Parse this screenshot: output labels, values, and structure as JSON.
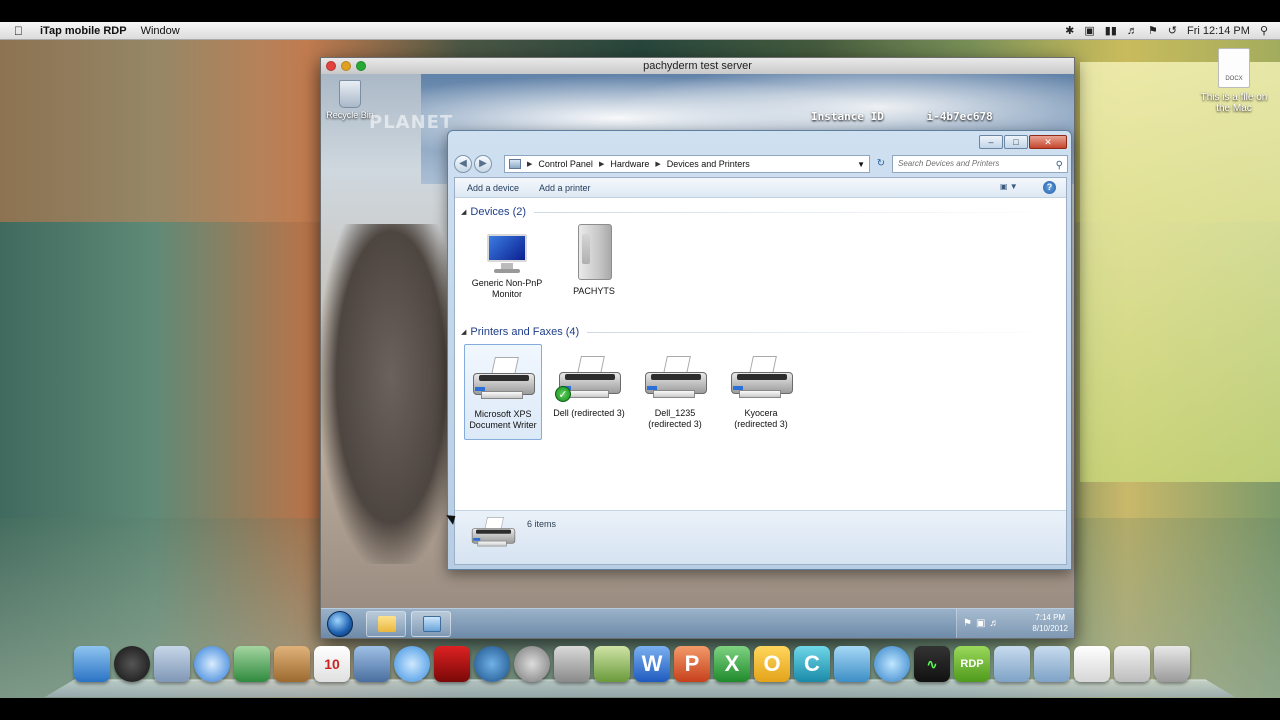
{
  "mac": {
    "menubar": {
      "apple": "",
      "app_name": "iTap mobile RDP",
      "menu_window": "Window",
      "clock": "Fri 12:14 PM",
      "status_icons": [
        "bluetooth-icon",
        "display-icon",
        "battery-icon",
        "volume-icon",
        "flag-icon",
        "timemachine-icon",
        "spotlight-icon"
      ]
    },
    "desktop_file": {
      "badge": "DOCX",
      "label": "This is a file on the Mac"
    },
    "dock_icons": [
      "finder",
      "dashboard",
      "preview",
      "safari",
      "facetime",
      "address-book",
      "ical",
      "iphoto",
      "itunes",
      "photobooth",
      "time-machine",
      "system-preferences",
      "installer",
      "stickies",
      "word",
      "powerpoint",
      "excel",
      "outlook",
      "messenger",
      "lync",
      "network",
      "activity-monitor",
      "rdp",
      "folder",
      "documents",
      "file",
      "keyboard",
      "trash"
    ]
  },
  "rdp": {
    "window_title": "pachyderm test server",
    "win_desktop": {
      "recycle_bin": "Recycle Bin",
      "logo_text": "PLANET",
      "instance_label": "Instance ID",
      "instance_value": "i-4b7ec678"
    },
    "taskbar": {
      "time": "7:14 PM",
      "date": "8/10/2012"
    }
  },
  "devices_printers": {
    "breadcrumb": [
      "Control Panel",
      "Hardware",
      "Devices and Printers"
    ],
    "search_placeholder": "Search Devices and Printers",
    "commands": {
      "add_device": "Add a device",
      "add_printer": "Add a printer"
    },
    "groups": {
      "devices": {
        "title": "Devices (2)",
        "items": [
          {
            "label": "Generic Non-PnP Monitor",
            "icon": "monitor-icon"
          },
          {
            "label": "PACHYTS",
            "icon": "computer-icon"
          }
        ]
      },
      "printers": {
        "title": "Printers and Faxes (4)",
        "items": [
          {
            "label": "Microsoft XPS Document Writer",
            "icon": "printer-icon",
            "selected": true
          },
          {
            "label": "Dell (redirected 3)",
            "icon": "printer-icon",
            "default": true
          },
          {
            "label": "Dell_1235 (redirected 3)",
            "icon": "printer-icon"
          },
          {
            "label": "Kyocera (redirected 3)",
            "icon": "printer-icon"
          }
        ]
      }
    },
    "status": {
      "count": "6 items"
    }
  }
}
